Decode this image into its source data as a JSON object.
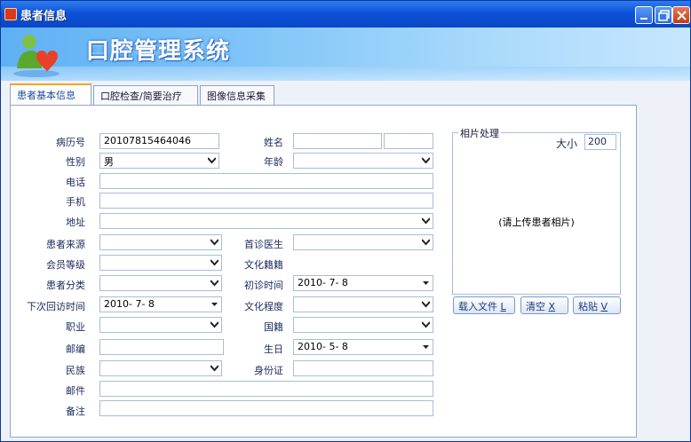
{
  "window": {
    "title": "患者信息",
    "app_title": "口腔管理系统"
  },
  "tabs": [
    {
      "label": "患者基本信息",
      "active": true
    },
    {
      "label": "口腔检查/简要治疗",
      "active": false
    },
    {
      "label": "图像信息采集",
      "active": false
    }
  ],
  "form": {
    "record_no": {
      "label": "病历号",
      "value": "20107815464046"
    },
    "name": {
      "label": "姓名",
      "value": "",
      "value2": ""
    },
    "gender": {
      "label": "性别",
      "value": "男"
    },
    "age": {
      "label": "年龄",
      "value": ""
    },
    "phone": {
      "label": "电话",
      "value": ""
    },
    "mobile": {
      "label": "手机",
      "value": ""
    },
    "address": {
      "label": "地址",
      "value": ""
    },
    "source": {
      "label": "患者来源",
      "value": ""
    },
    "first_doctor": {
      "label": "首诊医生",
      "value": ""
    },
    "member_level": {
      "label": "会员等级",
      "value": ""
    },
    "hometown": {
      "label": "文化籍籍",
      "value": ""
    },
    "category": {
      "label": "患者分类",
      "value": ""
    },
    "first_visit": {
      "label": "初诊时间",
      "value": "2010- 7- 8"
    },
    "next_visit": {
      "label": "下次回访时间",
      "value": "2010- 7- 8"
    },
    "education": {
      "label": "文化程度",
      "value": ""
    },
    "occupation": {
      "label": "职业",
      "value": ""
    },
    "nationality": {
      "label": "国籍",
      "value": ""
    },
    "postcode": {
      "label": "邮编",
      "value": ""
    },
    "birthday": {
      "label": "生日",
      "value": "2010- 5- 8"
    },
    "ethnicity": {
      "label": "民族",
      "value": ""
    },
    "id_card": {
      "label": "身份证",
      "value": ""
    },
    "email": {
      "label": "邮件",
      "value": ""
    },
    "remarks": {
      "label": "备注",
      "value": ""
    }
  },
  "photo": {
    "group_label": "相片处理",
    "size_label": "大小",
    "size_value": "200",
    "hint": "(请上传患者相片)",
    "load_button": "载入文件",
    "load_key": "L",
    "clear_button": "清空",
    "clear_key": "X",
    "paste_button": "粘贴",
    "paste_key": "V"
  },
  "colors": {
    "titlebar": "#0c52d8",
    "accent_tab": "#f5a623",
    "label_text": "#1a2a5a"
  }
}
